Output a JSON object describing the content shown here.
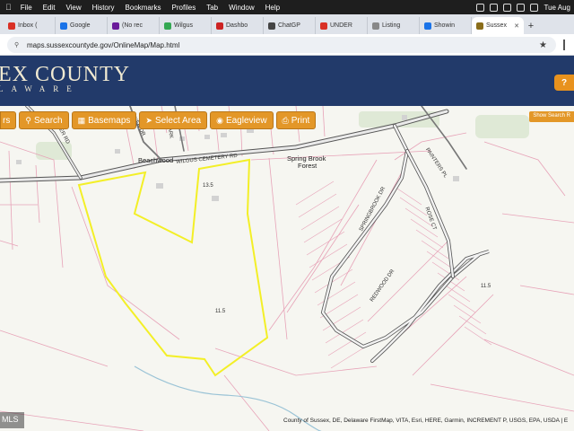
{
  "menubar": {
    "items": [
      "File",
      "Edit",
      "View",
      "History",
      "Bookmarks",
      "Profiles",
      "Tab",
      "Window",
      "Help"
    ],
    "clock": "Tue Aug"
  },
  "tabs": [
    {
      "label": "Inbox (",
      "color": "#d93025"
    },
    {
      "label": "Google",
      "color": "#1a73e8"
    },
    {
      "label": "(No rec",
      "color": "#6a1b9a"
    },
    {
      "label": "Wilgus",
      "color": "#34a853"
    },
    {
      "label": "Dashbo",
      "color": "#cc2222"
    },
    {
      "label": "ChatGP",
      "color": "#444444"
    },
    {
      "label": "UNDER",
      "color": "#d93025"
    },
    {
      "label": "Listing",
      "color": "#888888"
    },
    {
      "label": "Showin",
      "color": "#1a73e8"
    },
    {
      "label": "Sussex",
      "color": "#8a6d1a",
      "active": true
    }
  ],
  "address": {
    "url": "maps.sussexcountyde.gov/OnlineMap/Map.html"
  },
  "header": {
    "title": "EX COUNTY",
    "subtitle": "LAWARE",
    "help": "?"
  },
  "toolbar": {
    "layers": "rs",
    "search": "Search",
    "basemaps": "Basemaps",
    "select_area": "Select Area",
    "eagleview": "Eagleview",
    "print": "Print"
  },
  "show_search": "Show Search R",
  "map_labels": {
    "road_main": "WILGUS CEMETERY RD",
    "beachwood": "Beachwood",
    "spring_brook": "Spring Brook",
    "forest": "Forest",
    "potter_rd": "POTTER RD",
    "dyer_dr": "DYER DR",
    "clark": "CLARK",
    "springbrook_dr": "SPRINGBROOK DR",
    "rosewood": "ROSE CT",
    "redwood": "REDWOOD DR",
    "painters": "PAINTERS PL",
    "parcel_a": "13.5",
    "parcel_b": "11.5",
    "parcel_c": "11.5"
  },
  "attribution": "County of Sussex, DE, Delaware FirstMap, VITA, Esri, HERE, Garmin, INCREMENT P, USGS, EPA, USDA | E",
  "mls": "MLS",
  "colors": {
    "header_bg": "#223a6a",
    "button_bg": "#e39728",
    "parcel_line": "#e39bb0",
    "selection": "#f2ef2a",
    "road": "#505050"
  }
}
